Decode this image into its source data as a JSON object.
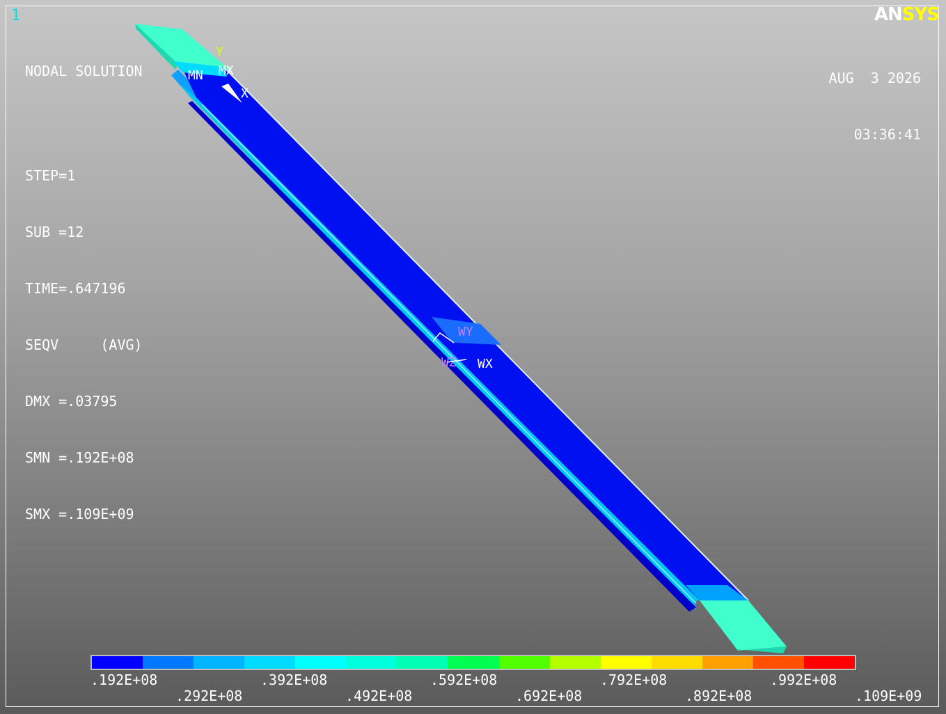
{
  "window_number": "1",
  "logo": {
    "part1": "AN",
    "part2": "SYS"
  },
  "info": {
    "title": "NODAL SOLUTION",
    "lines": [
      "STEP=1",
      "SUB =12",
      "TIME=.647196",
      "SEQV     (AVG)",
      "DMX =.03795",
      "SMN =.192E+08",
      "SMX =.109E+09"
    ]
  },
  "date": "AUG  3 2026",
  "time": "03:36:41",
  "markers": {
    "min": "MN",
    "max": "MX",
    "axis_x": "X",
    "axis_y": "Y",
    "wy": "WY",
    "wx": "WX",
    "wz": "WZ"
  },
  "legend": {
    "colors": [
      "#0000ff",
      "#0078ff",
      "#00b4ff",
      "#00dcff",
      "#00ffff",
      "#00ffdc",
      "#00ffb4",
      "#00ff50",
      "#50ff00",
      "#b4ff00",
      "#ffff00",
      "#ffdc00",
      "#ffa000",
      "#ff5000",
      "#ff0000"
    ],
    "labels_top": [
      ".192E+08",
      ".392E+08",
      ".592E+08",
      ".792E+08",
      ".992E+08"
    ],
    "labels_bottom": [
      ".292E+08",
      ".492E+08",
      ".692E+08",
      ".892E+08",
      ".109E+09"
    ]
  }
}
